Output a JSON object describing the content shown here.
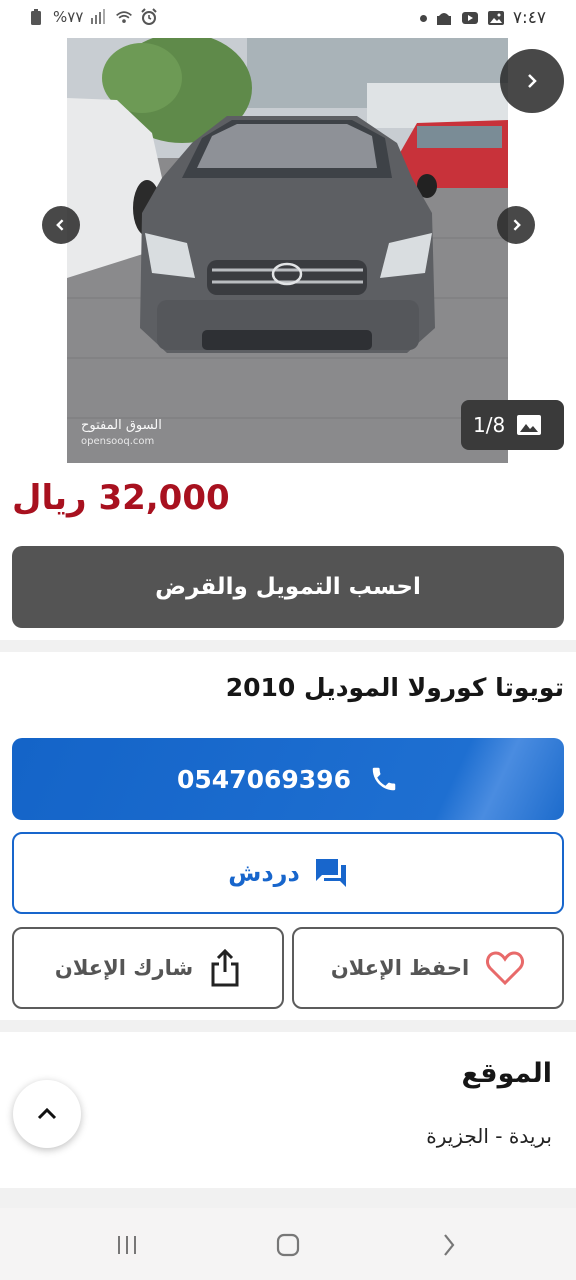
{
  "status_bar": {
    "time": "٧:٤٧",
    "battery": "%٧٧",
    "right_icons": [
      "image-icon",
      "youtube-icon",
      "app-icon",
      "notification-dot-icon"
    ],
    "left_icons": [
      "battery-icon",
      "signal-icon",
      "wifi-icon",
      "alarm-icon"
    ]
  },
  "gallery": {
    "counter": "1/8",
    "watermark_ar": "السوق المفتوح",
    "watermark_en": "opensooq.com"
  },
  "listing": {
    "price": "32,000 ريال",
    "finance_label": "احسب التمويل والقرض",
    "title": "تويوتا كورولا الموديل 2010",
    "phone": "0547069396",
    "chat_label": "دردش",
    "save_label": "احفظ الإعلان",
    "share_label": "شارك الإعلان"
  },
  "location": {
    "title": "الموقع",
    "value": "بريدة - الجزيرة"
  },
  "colors": {
    "price": "#a8111f",
    "primary_blue": "#1866cc",
    "finance_btn": "#545454",
    "heart": "#e86a6a"
  },
  "navbar": {
    "icons": [
      "recent-apps-icon",
      "home-icon",
      "back-icon"
    ]
  }
}
